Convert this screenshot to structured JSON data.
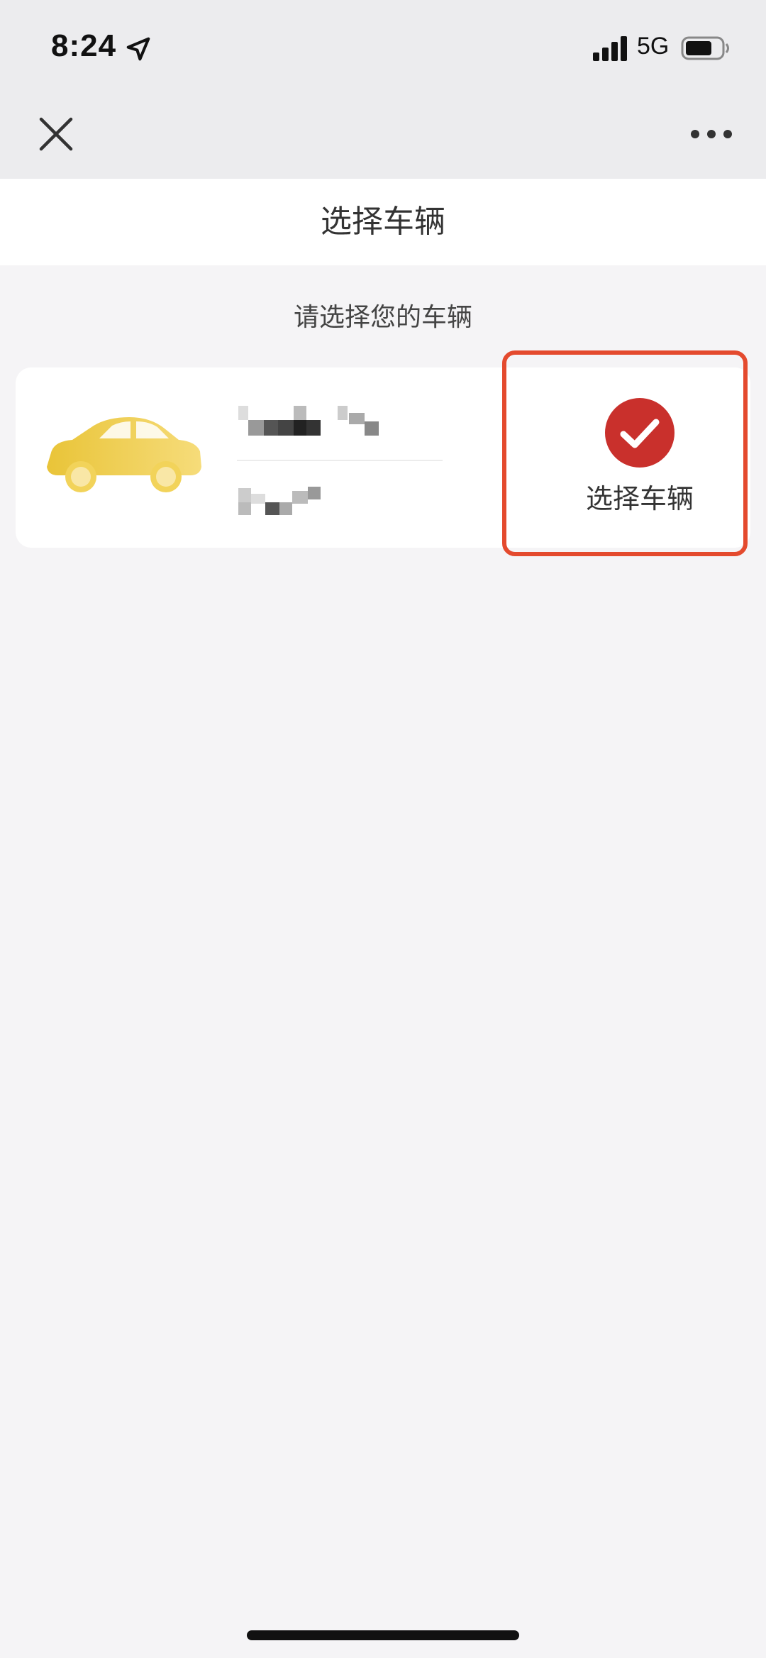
{
  "status_bar": {
    "time": "8:24",
    "network": "5G"
  },
  "page": {
    "title": "选择车辆",
    "subtitle": "请选择您的车辆"
  },
  "vehicle_card": {
    "select_label": "选择车辆"
  },
  "colors": {
    "accent_red": "#c9302c",
    "highlight_border": "#e44a2e",
    "car_gold": "#f0c93a",
    "background": "#f5f4f6"
  }
}
